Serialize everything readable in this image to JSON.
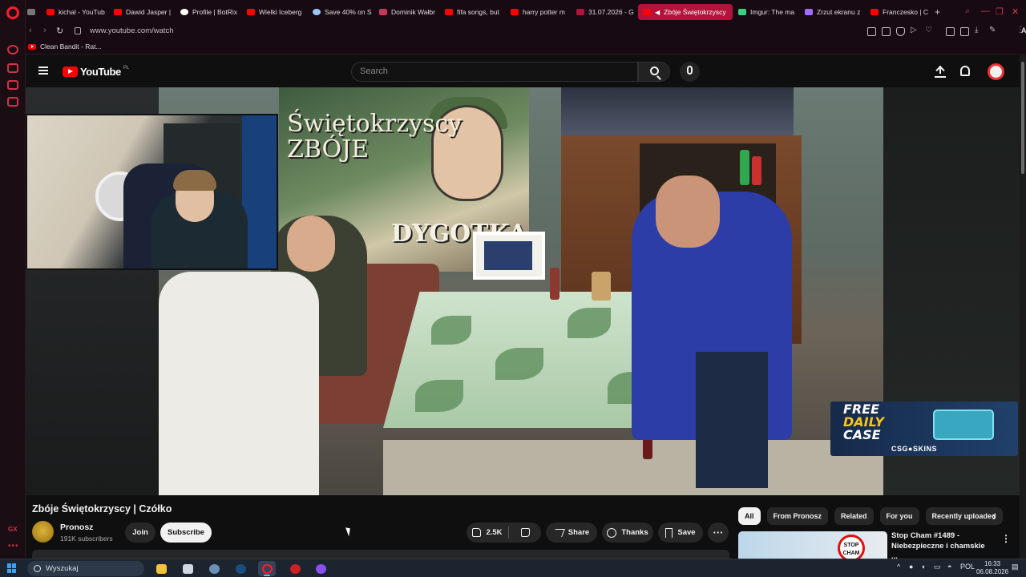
{
  "browser": {
    "tabs": [
      {
        "label": "kichal - YouTub",
        "color": "#ff0000"
      },
      {
        "label": "Dawid Jasper |",
        "color": "#ff0000"
      },
      {
        "label": "Profile | BotRix",
        "color": "#ffffff"
      },
      {
        "label": "Wielki Iceberg",
        "color": "#ff0000"
      },
      {
        "label": "Save 40% on S",
        "color": "#9ec7ff"
      },
      {
        "label": "Dominik Wałbr",
        "color": "#c03a5a"
      },
      {
        "label": "fifa songs, but",
        "color": "#ff0000"
      },
      {
        "label": "harry potter m",
        "color": "#ff0000"
      },
      {
        "label": "31.07.2026 - G",
        "color": "#b3133a"
      },
      {
        "label": "Zbóje Świętokrzyscy",
        "color": "#ffffff"
      },
      {
        "label": "Imgur: The ma",
        "color": "#39d27e"
      },
      {
        "label": "Zrzut ekranu z",
        "color": "#a06bff"
      },
      {
        "label": "Franczesko | C",
        "color": "#ff0000"
      }
    ],
    "active_tab_index": 9,
    "url": "www.youtube.com/watch",
    "ai_label": "AI",
    "bookmark": "Clean Bandit - Rat..."
  },
  "youtube": {
    "logo_text": "YouTube",
    "region": "PL",
    "search_placeholder": "Search"
  },
  "video_overlay": {
    "mural_line1": "Świętokrzyscy",
    "mural_line2": "ZBÓJE",
    "mural_sub": "DYGOTKA",
    "ad_line1": "FREE",
    "ad_line2": "DAILY",
    "ad_line3": "CASE",
    "ad_brand": "CSG●SKINS"
  },
  "video": {
    "title": "Zbóje Świętokrzyscy | Czółko",
    "channel": "Pronosz",
    "subscribers": "191K subscribers",
    "join_label": "Join",
    "subscribe_label": "Subscribe",
    "likes": "2.5K",
    "share_label": "Share",
    "thanks_label": "Thanks",
    "save_label": "Save"
  },
  "chips": [
    "All",
    "From Pronosz",
    "Related",
    "For you",
    "Recently uploaded"
  ],
  "recommended": {
    "title": "Stop Cham #1489 - Niebezpieczne i chamskie ...",
    "thumb_text": "STOP CHAM"
  },
  "taskbar": {
    "search_label": "Wyszukaj",
    "lang": "POL",
    "time": "16:33",
    "date": "06.08.2026"
  }
}
